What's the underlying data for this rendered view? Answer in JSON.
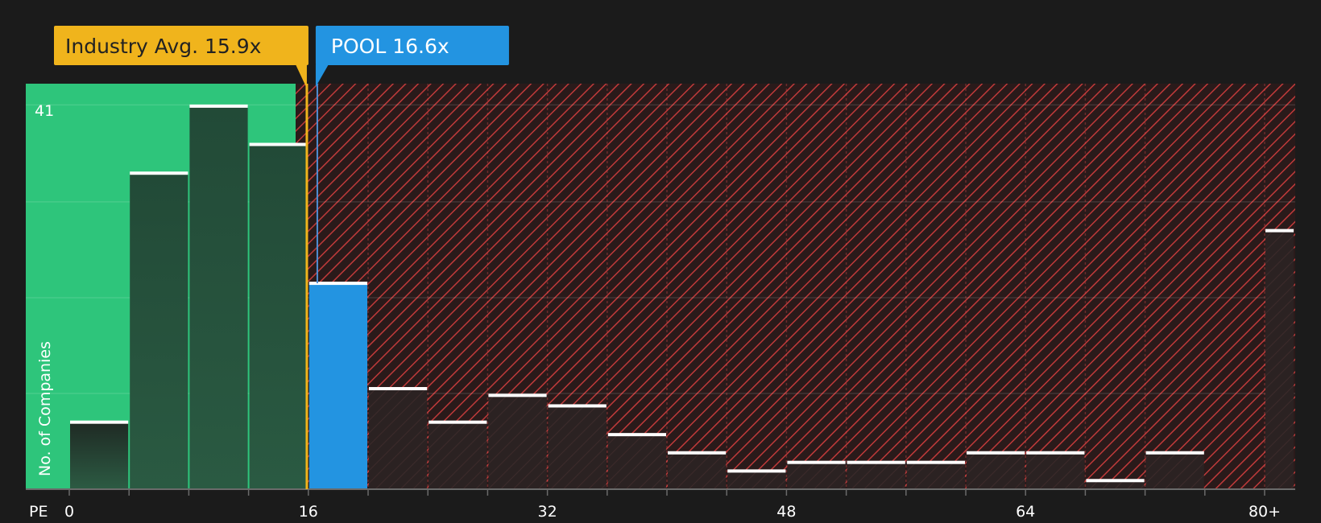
{
  "chart_data": {
    "type": "bar",
    "xlabel": "PE",
    "ylabel": "No. of Companies",
    "ymax_label": "41",
    "x_tick_labels": [
      "0",
      "16",
      "32",
      "48",
      "64",
      "80+"
    ],
    "bins": [
      {
        "from": 0,
        "to": 4,
        "count": 7
      },
      {
        "from": 4,
        "to": 8,
        "count": 33
      },
      {
        "from": 8,
        "to": 12,
        "count": 40
      },
      {
        "from": 12,
        "to": 16,
        "count": 36
      },
      {
        "from": 16,
        "to": 20,
        "count": 21.5
      },
      {
        "from": 20,
        "to": 24,
        "count": 10.5
      },
      {
        "from": 24,
        "to": 28,
        "count": 7
      },
      {
        "from": 28,
        "to": 32,
        "count": 9.8
      },
      {
        "from": 32,
        "to": 36,
        "count": 8.7
      },
      {
        "from": 36,
        "to": 40,
        "count": 5.7
      },
      {
        "from": 40,
        "to": 44,
        "count": 3.8
      },
      {
        "from": 44,
        "to": 48,
        "count": 1.9
      },
      {
        "from": 48,
        "to": 52,
        "count": 2.8
      },
      {
        "from": 52,
        "to": 56,
        "count": 2.8
      },
      {
        "from": 56,
        "to": 60,
        "count": 2.8
      },
      {
        "from": 60,
        "to": 64,
        "count": 3.8
      },
      {
        "from": 64,
        "to": 68,
        "count": 3.8
      },
      {
        "from": 68,
        "to": 72,
        "count": 0.9
      },
      {
        "from": 72,
        "to": 76,
        "count": 3.8
      },
      {
        "from": 76,
        "to": 80,
        "count": 0
      },
      {
        "from": 80,
        "to": 82,
        "count": 27
      }
    ],
    "ylim": [
      0,
      42.5
    ],
    "y_grid_step": 10,
    "industry_avg": {
      "label": "Industry Avg. 15.9x",
      "value": 15.9
    },
    "company": {
      "label": "POOL 16.6x",
      "value": 16.6
    },
    "colors": {
      "background": "#1b1b1b",
      "undervalued_zone": "#2ec57b",
      "overvalued_hatch": "#c03a3a",
      "industry": "#f0b41c",
      "company": "#2394e1",
      "bar_dark": "#244c39",
      "bar_over": "#2a2020"
    }
  }
}
